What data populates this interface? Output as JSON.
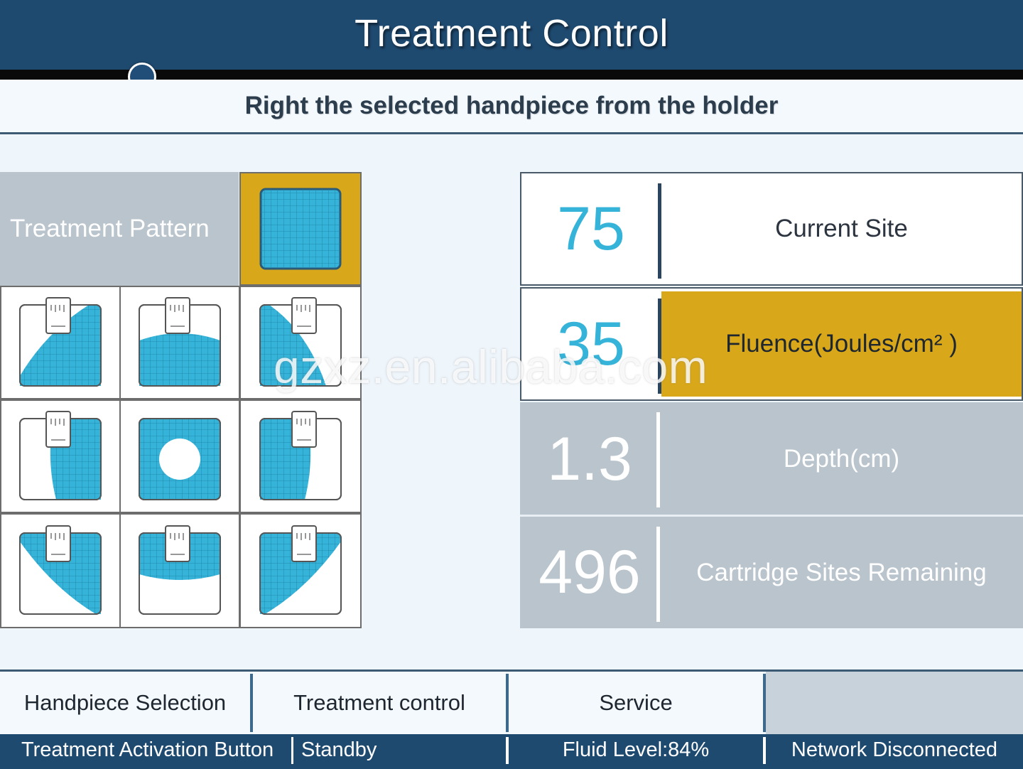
{
  "header": {
    "title": "Treatment Control"
  },
  "instruction": "Right the selected handpiece from the holder",
  "pattern": {
    "label": "Treatment Pattern",
    "selected_icon": "full-square-pattern-icon",
    "items": [
      {
        "icon": "pattern-bottom-right-curve-icon"
      },
      {
        "icon": "pattern-bottom-arc-icon"
      },
      {
        "icon": "pattern-left-curve-icon"
      },
      {
        "icon": "pattern-right-half-icon"
      },
      {
        "icon": "pattern-center-hole-icon"
      },
      {
        "icon": "pattern-left-half-icon"
      },
      {
        "icon": "pattern-top-left-curve-icon"
      },
      {
        "icon": "pattern-top-arc-icon"
      },
      {
        "icon": "pattern-top-right-curve-icon"
      }
    ]
  },
  "stats": {
    "current_site": {
      "value": "75",
      "label": "Current Site"
    },
    "fluence": {
      "value": "35",
      "label": "Fluence(Joules/cm² )"
    },
    "depth": {
      "value": "1.3",
      "label": "Depth(cm)"
    },
    "cartridge": {
      "value": "496",
      "label": "Cartridge Sites Remaining"
    }
  },
  "tabs": [
    {
      "label": "Handpiece Selection"
    },
    {
      "label": "Treatment control"
    },
    {
      "label": "Service"
    },
    {
      "label": ""
    }
  ],
  "status": {
    "activation": "Treatment Activation Button",
    "state": "Standby",
    "fluid": "Fluid Level:84%",
    "network": "Network Disconnected"
  },
  "watermark": "gzxz.en.alibaba.com",
  "colors": {
    "header_bg": "#1f4a70",
    "accent_gold": "#d9a81a",
    "pattern_blue": "#35b3d8",
    "panel_gray": "#b9c4cd"
  }
}
